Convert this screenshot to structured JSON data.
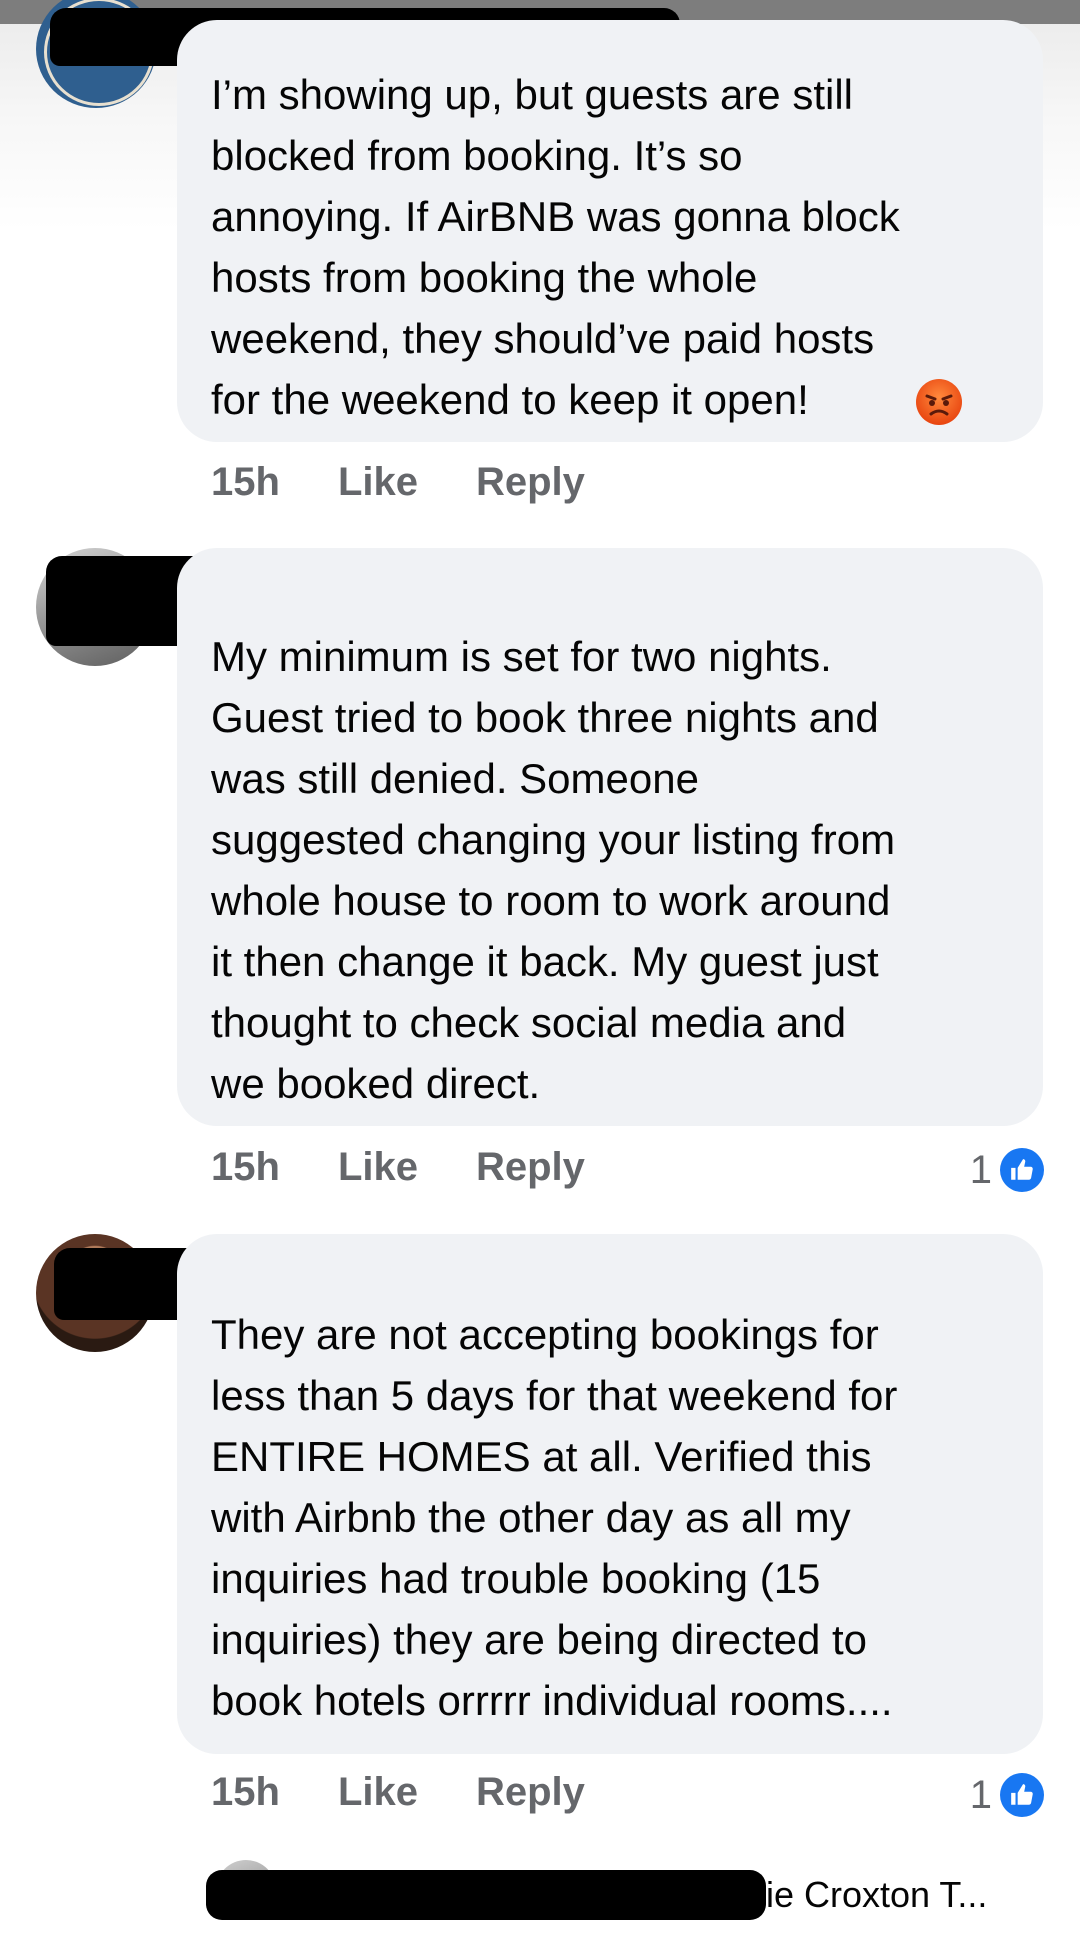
{
  "comments": [
    {
      "text": "I’m showing up, but guests are still\nblocked from booking. It’s so\nannoying. If AirBNB was gonna block\nhosts from booking the whole\nweekend, they should’ve paid hosts\nfor the weekend to keep it open!",
      "emoji": "angry-face-icon",
      "time": "15h",
      "like_label": "Like",
      "reply_label": "Reply"
    },
    {
      "text": "My minimum is set for two nights.\nGuest tried to book three nights and\nwas still denied.  Someone\nsuggested changing your listing from\nwhole house to room to work around\nit then change it back. My guest just\nthought to check social media and\nwe booked direct.",
      "time": "15h",
      "like_label": "Like",
      "reply_label": "Reply",
      "reaction_count": "1",
      "reaction_icon": "thumbs-up-icon"
    },
    {
      "text": "They are not accepting bookings for\nless than 5 days for that weekend for\nENTIRE HOMES at all.  Verified this\nwith Airbnb the other day as all my\ninquiries had trouble booking (15\ninquiries) they are being directed to\nbook hotels orrrrr individual rooms....",
      "time": "15h",
      "like_label": "Like",
      "reply_label": "Reply",
      "reaction_count": "1",
      "reaction_icon": "thumbs-up-icon"
    }
  ],
  "partial_comment": {
    "name_fragment": "ie Croxton T..."
  },
  "colors": {
    "bubble": "#f0f2f5",
    "meta_text": "#65676b",
    "like_blue": "#1877f2",
    "redaction": "#000000"
  }
}
